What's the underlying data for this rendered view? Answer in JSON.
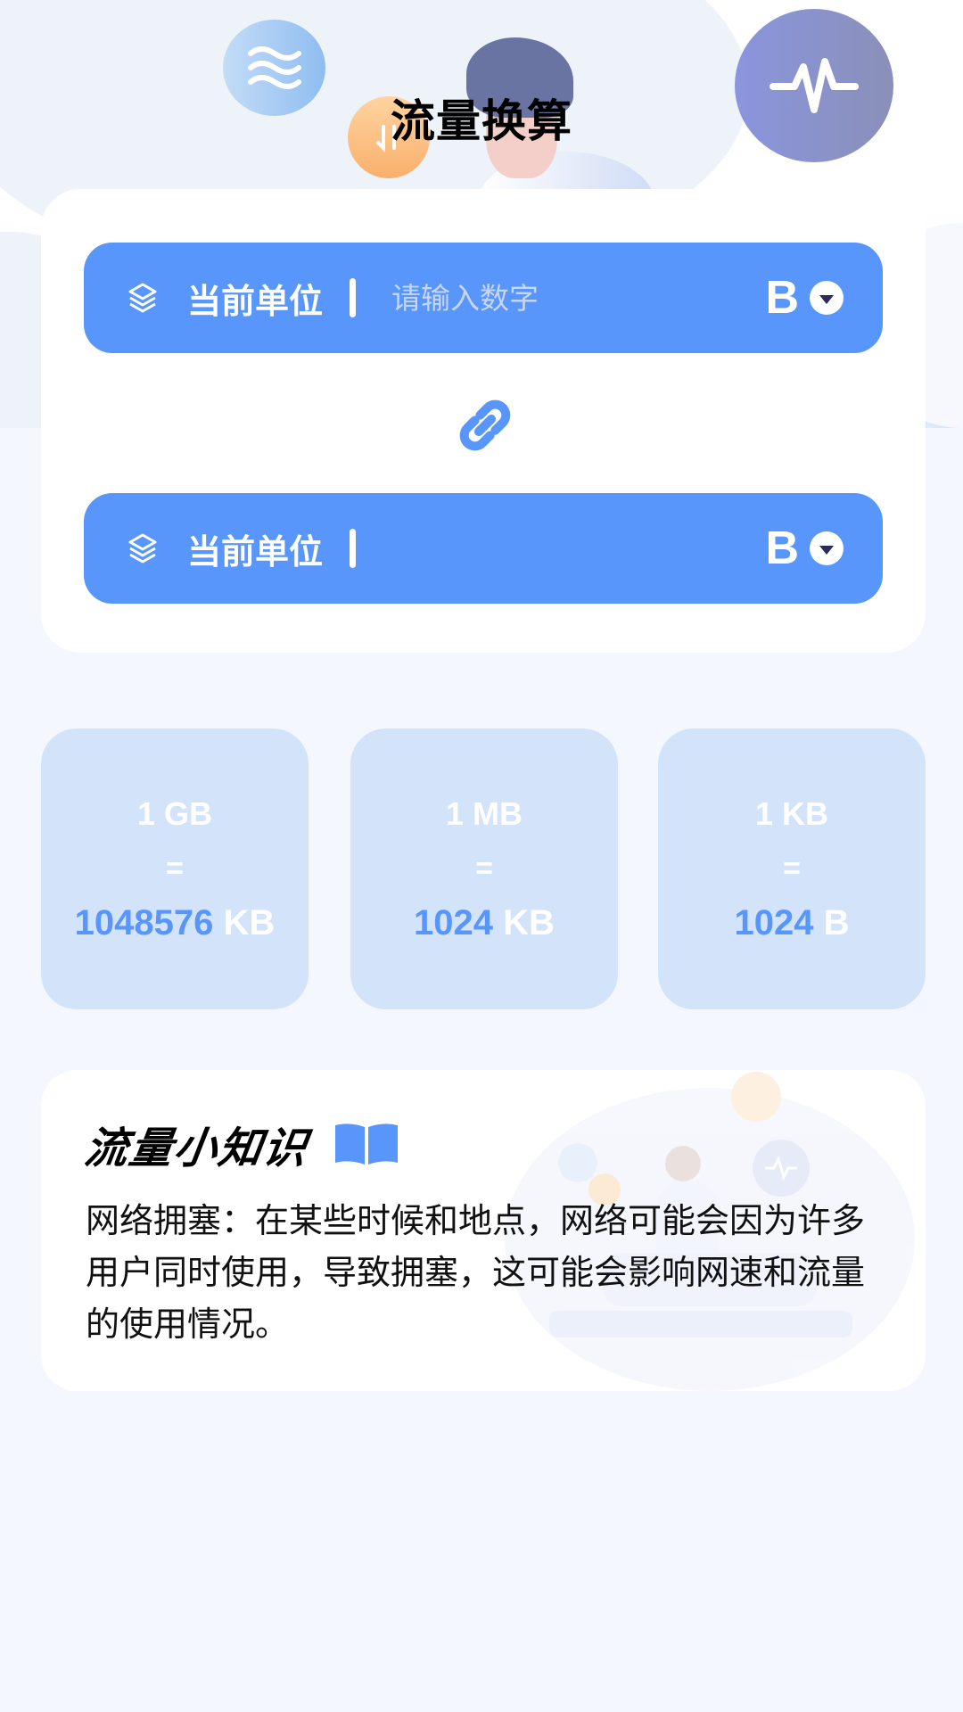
{
  "header": {
    "title": "流量换算"
  },
  "converter": {
    "source": {
      "label": "当前单位",
      "placeholder": "请输入数字",
      "value": "",
      "unit": "B"
    },
    "target": {
      "label": "当前单位",
      "placeholder": "",
      "value": "",
      "unit": "B"
    },
    "link_icon": "link-icon"
  },
  "reference": [
    {
      "from": "1 GB",
      "eq": "=",
      "to_value": "1048576",
      "to_unit": "KB"
    },
    {
      "from": "1 MB",
      "eq": "=",
      "to_value": "1024",
      "to_unit": "KB"
    },
    {
      "from": "1 KB",
      "eq": "=",
      "to_value": "1024",
      "to_unit": "B"
    }
  ],
  "tips": {
    "title": "流量小知识",
    "icon": "book-icon",
    "body": "网络拥塞：在某些时候和地点，网络可能会因为许多用户同时使用，导致拥塞，这可能会影响网速和流量的使用情况。"
  },
  "colors": {
    "accent": "#5896fc",
    "tile_bg": "#d3e3fa",
    "page_bg": "#f4f7fd"
  }
}
